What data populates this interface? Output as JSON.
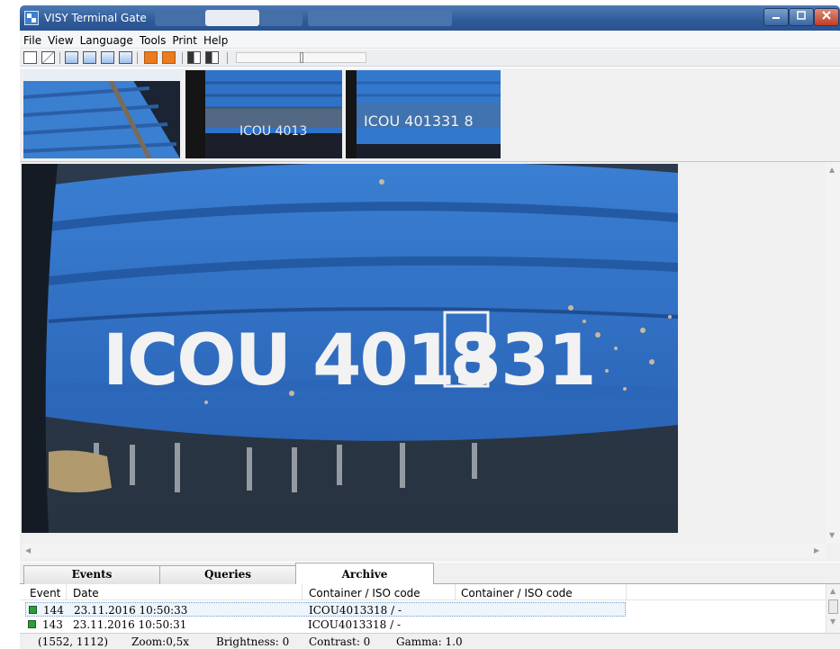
{
  "window": {
    "title": "VISY Terminal Gate"
  },
  "menu": [
    "File",
    "View",
    "Language",
    "Tools",
    "Print",
    "Help"
  ],
  "thumbnails": [
    {
      "name": "thumb-1",
      "code": ""
    },
    {
      "name": "thumb-2",
      "code": "ICOU 4013"
    },
    {
      "name": "thumb-3",
      "code": "ICOU 401331 8"
    }
  ],
  "main_image": {
    "code": "ICOU 401331",
    "check_digit": "8"
  },
  "tabs": [
    {
      "label": "Events",
      "active": false
    },
    {
      "label": "Queries",
      "active": false
    },
    {
      "label": "Archive",
      "active": true
    }
  ],
  "events": {
    "columns": [
      "Event",
      "Date",
      "Container / ISO code",
      "Container / ISO code"
    ],
    "rows": [
      {
        "event": "144",
        "date": "23.11.2016 10:50:33",
        "container": "ICOU4013318 / -",
        "container2": "",
        "selected": true
      },
      {
        "event": "143",
        "date": "23.11.2016 10:50:31",
        "container": "ICOU4013318 / -",
        "container2": "",
        "selected": false
      }
    ]
  },
  "status": {
    "coords": "(1552, 1112)",
    "zoom": "Zoom:0,5x",
    "brightness": "Brightness: 0",
    "contrast": "Contrast: 0",
    "gamma": "Gamma: 1.0"
  },
  "colors": {
    "titlebar": "#2f5b98",
    "container_blue": "#2a6bc4",
    "event_ok": "#2f9c3b"
  }
}
